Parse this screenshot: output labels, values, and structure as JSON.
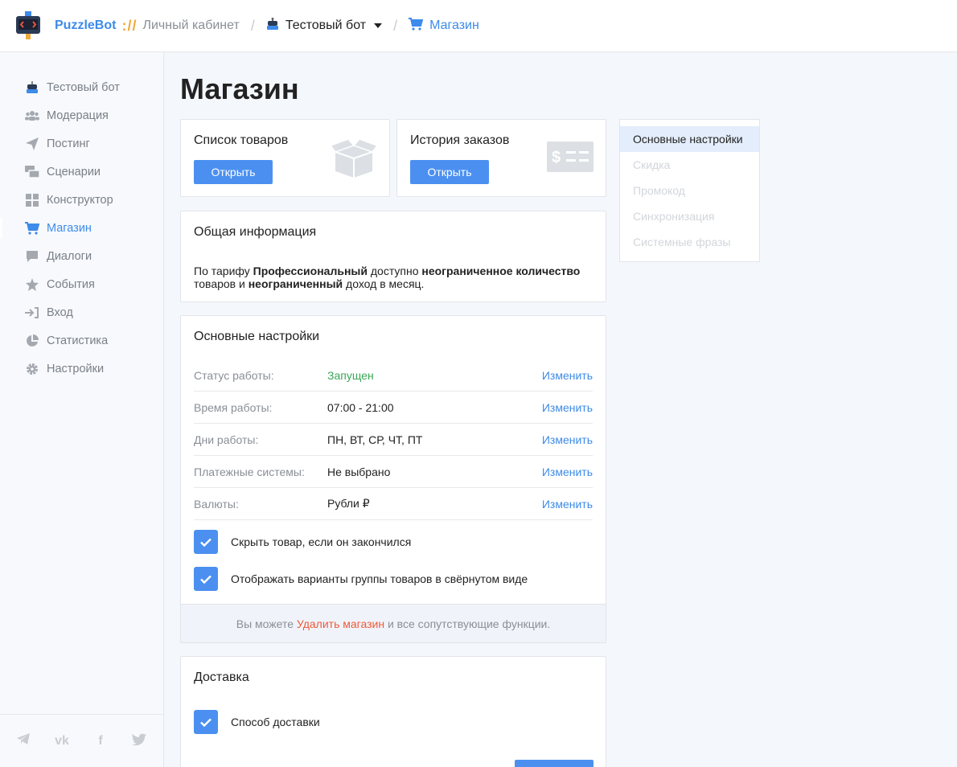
{
  "header": {
    "brand": "PuzzleBot",
    "separator": "://",
    "cabinet": "Личный кабинет",
    "bot_name": "Тестовый бот",
    "section": "Магазин"
  },
  "sidebar": {
    "items": [
      {
        "label": "Тестовый бот",
        "icon": "bot-icon"
      },
      {
        "label": "Модерация",
        "icon": "users-icon"
      },
      {
        "label": "Постинг",
        "icon": "paper-plane-icon"
      },
      {
        "label": "Сценарии",
        "icon": "scenario-icon"
      },
      {
        "label": "Конструктор",
        "icon": "grid-icon"
      },
      {
        "label": "Магазин",
        "icon": "cart-icon"
      },
      {
        "label": "Диалоги",
        "icon": "chat-icon"
      },
      {
        "label": "События",
        "icon": "star-icon"
      },
      {
        "label": "Вход",
        "icon": "sign-in-icon"
      },
      {
        "label": "Статистика",
        "icon": "pie-chart-icon"
      },
      {
        "label": "Настройки",
        "icon": "gear-icon"
      }
    ],
    "active_index": 5,
    "social": [
      "telegram-icon",
      "vk-icon",
      "facebook-icon",
      "twitter-icon"
    ]
  },
  "page": {
    "title": "Магазин"
  },
  "products_card": {
    "title": "Список товаров",
    "button": "Открыть",
    "icon": "box-icon"
  },
  "orders_card": {
    "title": "История заказов",
    "button": "Открыть",
    "icon": "money-icon"
  },
  "general_info": {
    "title": "Общая информация",
    "text_1": "По тарифу ",
    "plan": "Профессиональный",
    "text_2": " доступно ",
    "limit": "неограниченное количество",
    "text_3": "товаров и ",
    "income": "неограниченный",
    "text_4": " доход в месяц."
  },
  "main_settings": {
    "title": "Основные настройки",
    "rows": [
      {
        "label": "Статус работы:",
        "value": "Запущен",
        "action": "Изменить"
      },
      {
        "label": "Время работы:",
        "value": "07:00 - 21:00",
        "action": "Изменить"
      },
      {
        "label": "Дни работы:",
        "value": "ПН, ВТ, СР, ЧТ, ПТ",
        "action": "Изменить"
      },
      {
        "label": "Платежные системы:",
        "value": "Не выбрано",
        "action": "Изменить"
      },
      {
        "label": "Валюты:",
        "value": "Рубли ₽",
        "action": "Изменить"
      }
    ],
    "checkboxes": [
      {
        "label": "Скрыть товар, если он закончился",
        "checked": true
      },
      {
        "label": "Отображать варианты группы товаров в свёрнутом виде",
        "checked": true
      }
    ],
    "footer_prefix": "Вы можете ",
    "footer_link": "Удалить магазин",
    "footer_suffix": " и все сопутствующие функции."
  },
  "delivery": {
    "title": "Доставка",
    "checkbox": {
      "label": "Способ доставки",
      "checked": true
    }
  },
  "side_nav": {
    "items": [
      "Основные настройки",
      "Скидка",
      "Промокод",
      "Синхронизация",
      "Системные фразы"
    ],
    "active_index": 0
  },
  "colors": {
    "accent": "#4b90f0",
    "brand_orange": "#f2a93b",
    "status_ok": "#3aa655",
    "danger": "#f0593a"
  }
}
